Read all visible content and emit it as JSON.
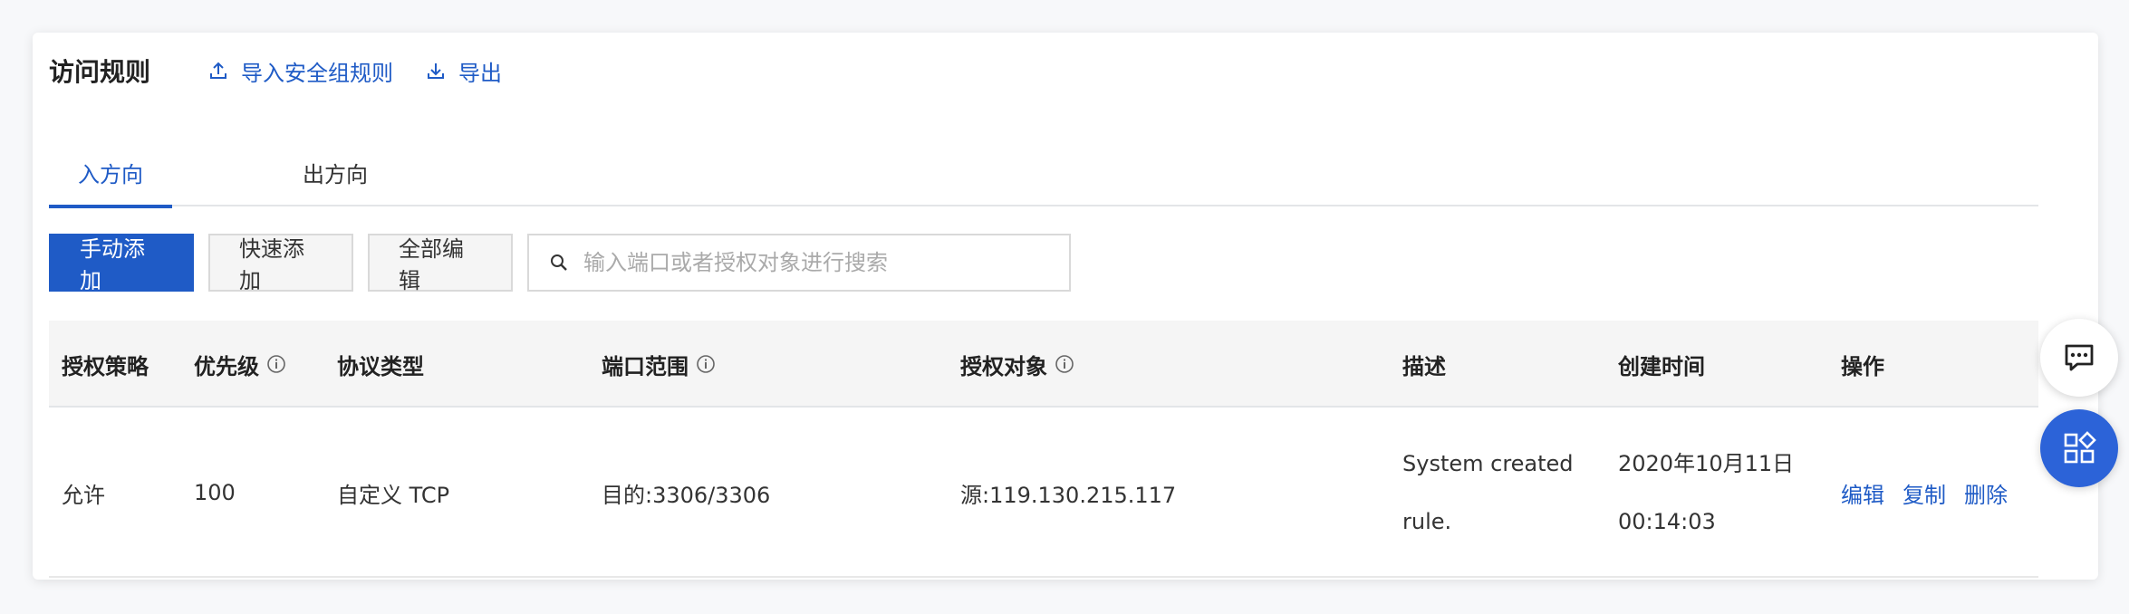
{
  "header": {
    "title": "访问规则",
    "import_label": "导入安全组规则",
    "export_label": "导出"
  },
  "tabs": [
    {
      "label": "入方向",
      "active": true
    },
    {
      "label": "出方向",
      "active": false
    }
  ],
  "toolbar": {
    "manual_add": "手动添加",
    "quick_add": "快速添加",
    "edit_all": "全部编辑",
    "search_placeholder": "输入端口或者授权对象进行搜索"
  },
  "table": {
    "columns": [
      "授权策略",
      "优先级",
      "协议类型",
      "端口范围",
      "授权对象",
      "描述",
      "创建时间",
      "操作"
    ],
    "rows": [
      {
        "policy": "允许",
        "priority": "100",
        "protocol": "自定义 TCP",
        "port_range": "目的:3306/3306",
        "auth_object": "源:119.130.215.117",
        "description_line1": "System created",
        "description_line2": "rule.",
        "created_date": "2020年10月11日",
        "created_time": "00:14:03",
        "actions": [
          "编辑",
          "复制",
          "删除"
        ]
      }
    ]
  },
  "colors": {
    "accent": "#1f5bc6",
    "float_blue": "#2c63d8"
  },
  "icons": {
    "import": "upload-icon",
    "export": "download-icon",
    "search": "search-icon",
    "info": "info-icon",
    "chat": "chat-icon",
    "apps": "apps-icon"
  }
}
